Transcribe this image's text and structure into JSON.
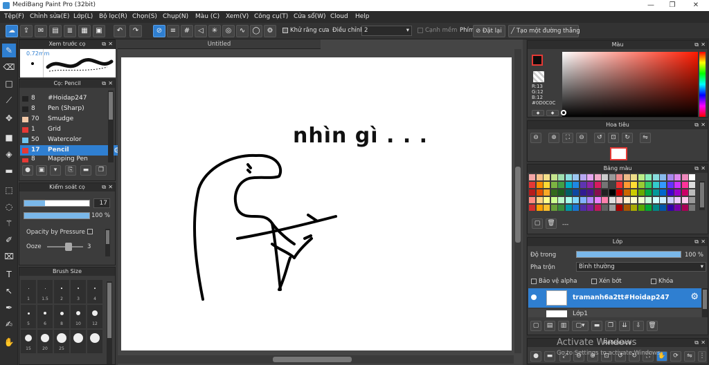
{
  "app": {
    "title": "MediBang Paint Pro (32bit)"
  },
  "menu": [
    "Tệp(F)",
    "Chỉnh sửa(E)",
    "Lớp(L)",
    "Bộ lọc(R)",
    "Chọn(S)",
    "Chụp(N)",
    "Màu (C)",
    "Xem(V)",
    "Công cụ(T)",
    "Cửa sổ(W)",
    "Cloud",
    "Help"
  ],
  "toolbar": {
    "antialias_label": "Khử răng cưa",
    "adjust_label": "Điều chỉnh",
    "adjust_value": "2",
    "sharp_edge_label": "Cạnh mềm",
    "keys_label": "Phím",
    "reset_label": "Đặt lại",
    "straight_line_label": "Tạo một đường thẳng"
  },
  "preview": {
    "title": "Xem trước cọ",
    "size": "0.72mm"
  },
  "brushes": {
    "title": "Cọ: Pencil",
    "items": [
      {
        "num": "8",
        "name": "#Hoidap247",
        "color": "#222222"
      },
      {
        "num": "8",
        "name": "Pen (Sharp)",
        "color": "#222222"
      },
      {
        "num": "70",
        "name": "Smudge",
        "color": "#f3c9a8"
      },
      {
        "num": "1",
        "name": "Grid",
        "color": "#e53935"
      },
      {
        "num": "50",
        "name": "Watercolor",
        "color": "#6ec6f0"
      },
      {
        "num": "17",
        "name": "Pencil",
        "color": "#e53935"
      },
      {
        "num": "8",
        "name": "Mapping Pen",
        "color": "#e53935"
      }
    ]
  },
  "brush_control": {
    "title": "Kiểm soát cọ",
    "size_value": "17",
    "opacity_value": "100 %",
    "pressure_label": "Opacity by Pressure",
    "ooze_label": "Ooze",
    "ooze_value": "3"
  },
  "brush_size": {
    "title": "Brush Size",
    "labels": [
      "1",
      "1.5",
      "2",
      "3",
      "4",
      "5",
      "6",
      "8",
      "10",
      "12",
      "15",
      "20",
      "25"
    ]
  },
  "document": {
    "tab": "Untitled",
    "drawing_text": "nhìn gì . . ."
  },
  "color_panel": {
    "title": "Màu",
    "r": "R:13",
    "g": "G:12",
    "b": "B:12",
    "hex": "#0D0C0C"
  },
  "navigator": {
    "title": "Hoa tiêu"
  },
  "palette": {
    "title": "Bảng màu",
    "extra": "---"
  },
  "layers": {
    "title": "Lớp",
    "opacity_label": "Độ trong",
    "opacity_value": "100 %",
    "blend_label": "Pha trộn",
    "blend_value": "Bình thường",
    "protect_alpha": "Bảo vệ alpha",
    "clip": "Xén bớt",
    "lock": "Khóa",
    "items": [
      {
        "name": "tramanh6a2tt#Hoidap247"
      },
      {
        "name": "Lớp1"
      }
    ]
  },
  "reference": {
    "title": "Reference"
  },
  "watermark": {
    "line1": "Activate Windows",
    "line2": "Go to Settings to activate Windows."
  },
  "colors": {
    "accent": "#2f7fd1",
    "panel": "#3c3c3c",
    "header": "#2d2d2d"
  }
}
